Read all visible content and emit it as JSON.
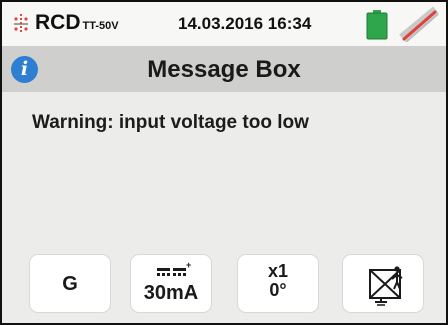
{
  "status_bar": {
    "mode": "RCD",
    "mode_sub": "TT-50V",
    "datetime": "14.03.2016  16:34",
    "icons": {
      "rcd": "rcd-icon",
      "battery": "battery-icon",
      "signal": "signal-off-icon"
    },
    "colors": {
      "battery": "#2fa64a",
      "signal_slash": "#e2413a"
    }
  },
  "title_bar": {
    "icon": "info-icon",
    "icon_glyph": "i",
    "title": "Message Box"
  },
  "message": "Warning: input voltage too low",
  "bottom_params": {
    "g_label": "G",
    "current_icon": "dc-pulse-icon",
    "current_value": "30mA",
    "multiplier": "x1",
    "phase": "0°",
    "touch_icon": "touch-voltage-disabled-icon"
  },
  "colors": {
    "accent_blue": "#2e7fd2",
    "title_bar_bg": "#cfcfcd",
    "screen_bg": "#ececea"
  }
}
